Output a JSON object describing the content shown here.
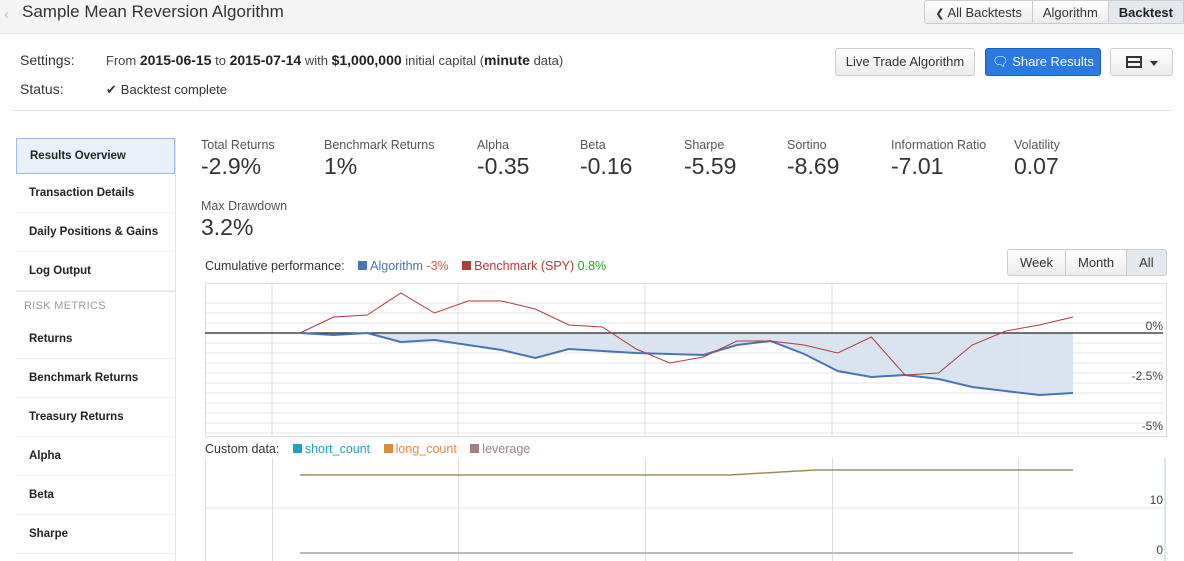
{
  "header": {
    "title": "Sample Mean Reversion Algorithm",
    "nav": [
      {
        "label": "All Backtests",
        "icon": "chevron-left-icon"
      },
      {
        "label": "Algorithm"
      },
      {
        "label": "Backtest",
        "active": true
      }
    ]
  },
  "settings": {
    "label": "Settings:",
    "from_word": "From",
    "start_date": "2015-06-15",
    "to_word": "to",
    "end_date": "2015-07-14",
    "with_word": "with",
    "capital": "$1,000,000",
    "capital_suffix": "initial capital (",
    "data_freq": "minute",
    "data_suffix": "data)"
  },
  "status": {
    "label": "Status:",
    "value": "Backtest complete",
    "icon": "checkmark-icon"
  },
  "actions": {
    "live_trade": "Live Trade Algorithm",
    "share": "Share Results",
    "share_icon": "comments-icon",
    "menu_icon": "table-icon"
  },
  "sidebar": {
    "items": [
      {
        "label": "Results Overview",
        "active": true
      },
      {
        "label": "Transaction Details"
      },
      {
        "label": "Daily Positions & Gains"
      },
      {
        "label": "Log Output"
      }
    ],
    "section_title": "RISK METRICS",
    "risk_items": [
      {
        "label": "Returns"
      },
      {
        "label": "Benchmark Returns"
      },
      {
        "label": "Treasury Returns"
      },
      {
        "label": "Alpha"
      },
      {
        "label": "Beta"
      },
      {
        "label": "Sharpe"
      }
    ]
  },
  "metrics": [
    {
      "label": "Total Returns",
      "value": "-2.9%"
    },
    {
      "label": "Benchmark Returns",
      "value": "1%"
    },
    {
      "label": "Alpha",
      "value": "-0.35"
    },
    {
      "label": "Beta",
      "value": "-0.16"
    },
    {
      "label": "Sharpe",
      "value": "-5.59"
    },
    {
      "label": "Sortino",
      "value": "-8.69"
    },
    {
      "label": "Information Ratio",
      "value": "-7.01"
    },
    {
      "label": "Volatility",
      "value": "0.07"
    },
    {
      "label": "Max Drawdown",
      "value": "3.2%"
    }
  ],
  "performance": {
    "title": "Cumulative performance:",
    "algo_label": "Algorithm",
    "algo_value": "-3%",
    "bench_label": "Benchmark (SPY)",
    "bench_value": "0.8%",
    "colors": {
      "algo": "#4a73b3",
      "bench": "#b33a3a",
      "algo_value": "#e15759",
      "bench_value": "#2ca02c",
      "fill": "#d6e0ee"
    },
    "range_buttons": [
      {
        "label": "Week"
      },
      {
        "label": "Month"
      },
      {
        "label": "All",
        "active": true
      }
    ]
  },
  "chart_data": [
    {
      "type": "line",
      "title": "Cumulative performance",
      "ylim": [
        -5,
        1
      ],
      "y_ticks": [
        "0%",
        "-2.5%",
        "-5%"
      ],
      "y_tick_values": [
        0,
        -2.5,
        -5
      ],
      "series": [
        {
          "name": "Algorithm",
          "values": [
            0,
            -0.1,
            0,
            -0.45,
            -0.35,
            -0.6,
            -0.85,
            -1.25,
            -0.8,
            -0.9,
            -1.0,
            -1.05,
            -1.1,
            -0.6,
            -0.4,
            -1.05,
            -1.9,
            -2.2,
            -2.1,
            -2.3,
            -2.7,
            -2.9,
            -3.1,
            -3.0
          ]
        },
        {
          "name": "Benchmark (SPY)",
          "values": [
            0,
            0.8,
            0.9,
            2.0,
            1.0,
            1.6,
            1.6,
            1.2,
            0.4,
            0.3,
            -0.8,
            -1.5,
            -1.2,
            -0.4,
            -0.4,
            -0.6,
            -1.0,
            -0.2,
            -2.1,
            -2.0,
            -0.6,
            0.1,
            0.4,
            0.8
          ]
        }
      ]
    },
    {
      "type": "line",
      "title": "Custom data",
      "ylim": [
        0,
        20
      ],
      "y_ticks": [
        "10",
        "0"
      ],
      "y_tick_values": [
        10,
        0
      ],
      "series": [
        {
          "name": "short_count",
          "values": [
            0,
            0,
            0,
            0,
            0,
            0,
            0,
            0,
            0,
            0
          ]
        },
        {
          "name": "long_count",
          "values": [
            16,
            16,
            16,
            16,
            16,
            16,
            17,
            17,
            17,
            17
          ]
        },
        {
          "name": "leverage",
          "values": [
            0,
            0,
            0,
            0,
            0,
            0,
            0,
            0,
            0,
            0
          ]
        }
      ]
    }
  ],
  "custom": {
    "title": "Custom data:",
    "series": [
      {
        "name": "short_count",
        "color": "#1fa2c5"
      },
      {
        "name": "long_count",
        "color": "#e08a3c"
      },
      {
        "name": "leverage",
        "color": "#a08080"
      }
    ],
    "line_color": "#9b8e5a",
    "flat_color": "#c0b8c0"
  }
}
